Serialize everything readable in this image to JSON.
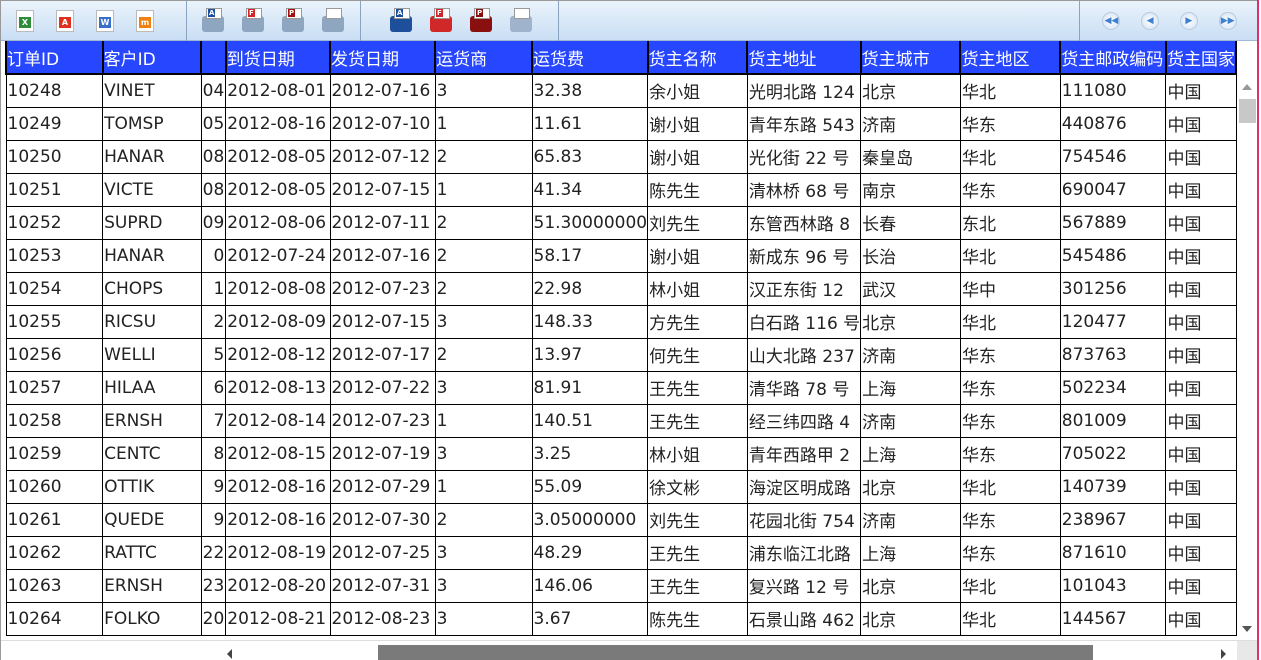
{
  "toolbar": {
    "export": [
      {
        "icon": "excel-export-icon",
        "glyph": "X",
        "color": "#2e8b3a"
      },
      {
        "icon": "pdf-export-icon",
        "glyph": "A",
        "color": "#e03020"
      },
      {
        "icon": "word-export-icon",
        "glyph": "W",
        "color": "#3a6fc8"
      },
      {
        "icon": "image-export-icon",
        "glyph": "m",
        "color": "#f08010"
      }
    ],
    "preview": [
      {
        "icon": "print-preview-a-icon",
        "glyph": "A",
        "color": "#1e4f9a"
      },
      {
        "icon": "print-preview-f-icon",
        "glyph": "F",
        "color": "#d02828"
      },
      {
        "icon": "print-preview-p-icon",
        "glyph": "P",
        "color": "#a01010"
      },
      {
        "icon": "print-preview-icon",
        "glyph": "",
        "color": "#ffffff"
      }
    ],
    "print": [
      {
        "icon": "print-a-icon",
        "glyph": "A",
        "color": "#1e4f9a"
      },
      {
        "icon": "print-f-icon",
        "glyph": "F",
        "color": "#d02828"
      },
      {
        "icon": "print-p-icon",
        "glyph": "P",
        "color": "#8a1010"
      },
      {
        "icon": "print-icon",
        "glyph": "",
        "color": "#9fb4cc"
      }
    ],
    "nav": [
      {
        "icon": "first-page-icon",
        "glyph": "◀◀"
      },
      {
        "icon": "prev-page-icon",
        "glyph": "◀"
      },
      {
        "icon": "next-page-icon",
        "glyph": "▶"
      },
      {
        "icon": "last-page-icon",
        "glyph": "▶▶"
      }
    ]
  },
  "table": {
    "header_color": "#2646ff",
    "columns": [
      "订单ID",
      "客户ID",
      "",
      "到货日期",
      "发货日期",
      "运货商",
      "运货费",
      "货主名称",
      "货主地址",
      "货主城市",
      "货主地区",
      "货主邮政编码",
      "货主国家"
    ],
    "rows": [
      [
        "10248",
        "VINET",
        "04",
        "2012-08-01",
        "2012-07-16",
        "3",
        "32.38",
        "余小姐",
        "光明北路 124",
        "北京",
        "华北",
        "111080",
        "中国"
      ],
      [
        "10249",
        "TOMSP",
        "05",
        "2012-08-16",
        "2012-07-10",
        "1",
        "11.61",
        "谢小姐",
        "青年东路 543",
        "济南",
        "华东",
        "440876",
        "中国"
      ],
      [
        "10250",
        "HANAR",
        "08",
        "2012-08-05",
        "2012-07-12",
        "2",
        "65.83",
        "谢小姐",
        "光化街 22 号",
        "秦皇岛",
        "华北",
        "754546",
        "中国"
      ],
      [
        "10251",
        "VICTE",
        "08",
        "2012-08-05",
        "2012-07-15",
        "1",
        "41.34",
        "陈先生",
        "清林桥 68 号",
        "南京",
        "华东",
        "690047",
        "中国"
      ],
      [
        "10252",
        "SUPRD",
        "09",
        "2012-08-06",
        "2012-07-11",
        "2",
        "51.30000000",
        "刘先生",
        "东管西林路 8",
        "长春",
        "东北",
        "567889",
        "中国"
      ],
      [
        "10253",
        "HANAR",
        "0",
        "2012-07-24",
        "2012-07-16",
        "2",
        "58.17",
        "谢小姐",
        "新成东 96 号",
        "长治",
        "华北",
        "545486",
        "中国"
      ],
      [
        "10254",
        "CHOPS",
        "1",
        "2012-08-08",
        "2012-07-23",
        "2",
        "22.98",
        "林小姐",
        "汉正东街 12",
        "武汉",
        "华中",
        "301256",
        "中国"
      ],
      [
        "10255",
        "RICSU",
        "2",
        "2012-08-09",
        "2012-07-15",
        "3",
        "148.33",
        "方先生",
        "白石路 116 号",
        "北京",
        "华北",
        "120477",
        "中国"
      ],
      [
        "10256",
        "WELLI",
        "5",
        "2012-08-12",
        "2012-07-17",
        "2",
        "13.97",
        "何先生",
        "山大北路 237",
        "济南",
        "华东",
        "873763",
        "中国"
      ],
      [
        "10257",
        "HILAA",
        "6",
        "2012-08-13",
        "2012-07-22",
        "3",
        "81.91",
        "王先生",
        "清华路 78 号",
        "上海",
        "华东",
        "502234",
        "中国"
      ],
      [
        "10258",
        "ERNSH",
        "7",
        "2012-08-14",
        "2012-07-23",
        "1",
        "140.51",
        "王先生",
        "经三纬四路 4",
        "济南",
        "华东",
        "801009",
        "中国"
      ],
      [
        "10259",
        "CENTC",
        "8",
        "2012-08-15",
        "2012-07-19",
        "3",
        "3.25",
        "林小姐",
        "青年西路甲 2",
        "上海",
        "华东",
        "705022",
        "中国"
      ],
      [
        "10260",
        "OTTIK",
        "9",
        "2012-08-16",
        "2012-07-29",
        "1",
        "55.09",
        "徐文彬",
        "海淀区明成路",
        "北京",
        "华北",
        "140739",
        "中国"
      ],
      [
        "10261",
        "QUEDE",
        "9",
        "2012-08-16",
        "2012-07-30",
        "2",
        "3.05000000",
        "刘先生",
        "花园北街 754",
        "济南",
        "华东",
        "238967",
        "中国"
      ],
      [
        "10262",
        "RATTC",
        "22",
        "2012-08-19",
        "2012-07-25",
        "3",
        "48.29",
        "王先生",
        "浦东临江北路",
        "上海",
        "华东",
        "871610",
        "中国"
      ],
      [
        "10263",
        "ERNSH",
        "23",
        "2012-08-20",
        "2012-07-31",
        "3",
        "146.06",
        "王先生",
        "复兴路 12 号",
        "北京",
        "华北",
        "101043",
        "中国"
      ],
      [
        "10264",
        "FOLKO",
        "20",
        "2012-08-21",
        "2012-08-23",
        "3",
        "3.67",
        "陈先生",
        "石景山路 462",
        "北京",
        "华北",
        "144567",
        "中国"
      ]
    ]
  }
}
